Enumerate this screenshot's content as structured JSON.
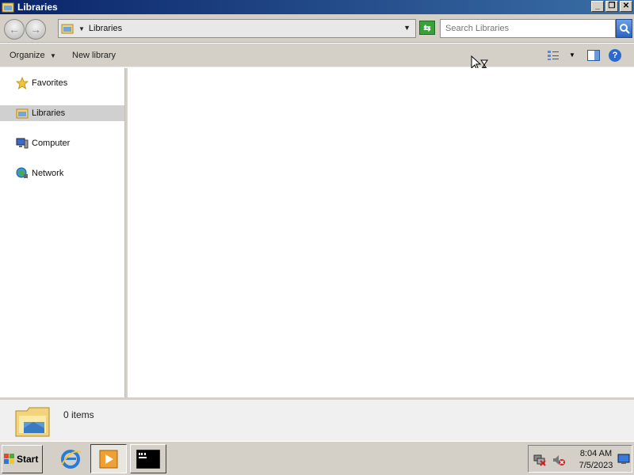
{
  "window": {
    "title": "Libraries",
    "controls": {
      "minimize": "_",
      "restore": "❐",
      "close": "✕"
    }
  },
  "address_bar": {
    "crumb": "Libraries",
    "search_placeholder": "Search Libraries"
  },
  "command_bar": {
    "organize_label": "Organize",
    "new_library_label": "New library",
    "help_label": "?"
  },
  "nav_pane": {
    "items": [
      {
        "label": "Favorites",
        "icon": "star-icon"
      },
      {
        "label": "Libraries",
        "icon": "libraries-icon",
        "selected": true
      },
      {
        "label": "Computer",
        "icon": "computer-icon"
      },
      {
        "label": "Network",
        "icon": "network-icon"
      }
    ]
  },
  "details_pane": {
    "item_count": "0 items"
  },
  "taskbar": {
    "start_label": "Start",
    "clock_time": "8:04 AM",
    "clock_date": "7/5/2023"
  },
  "colors": {
    "title_bar": "#0a246a",
    "chrome": "#d4d0c8",
    "selection": "#d0d0d0"
  }
}
